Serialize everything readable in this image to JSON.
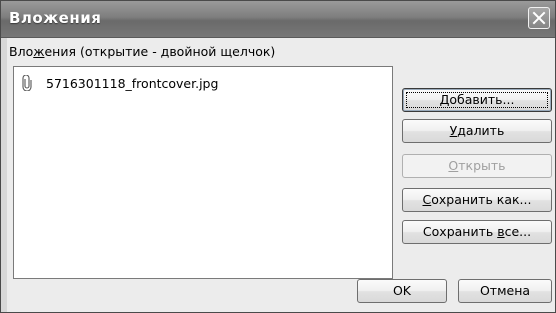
{
  "window": {
    "title": "Вложения"
  },
  "list": {
    "label_prefix": "Вло",
    "label_accel": "ж",
    "label_suffix": "ения (открытие - двойной щелчок)",
    "items": [
      {
        "icon": "paperclip-icon",
        "name": "5716301118_frontcover.jpg"
      }
    ]
  },
  "buttons": {
    "add": {
      "accel": "Д",
      "rest": "обавить..."
    },
    "delete": {
      "accel": "У",
      "rest": "далить"
    },
    "open": {
      "accel": "О",
      "rest": "ткрыть",
      "enabled": false
    },
    "save_as": {
      "accel": "С",
      "rest": "охранить как..."
    },
    "save_all": {
      "pre": "Сохранить ",
      "accel": "в",
      "rest": "се..."
    },
    "ok": {
      "label": "OK"
    },
    "cancel": {
      "label": "Отмена"
    }
  },
  "colors": {
    "titlebar": "#7e7e7e",
    "client": "#ececec",
    "disabled_text": "#a0a0a0"
  }
}
